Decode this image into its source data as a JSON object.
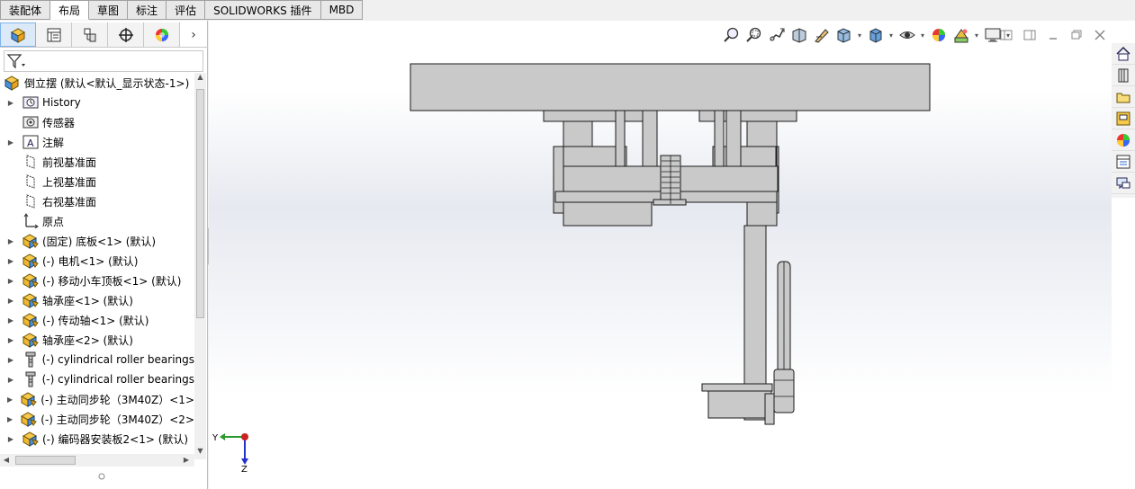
{
  "tabs": [
    {
      "label": "装配体",
      "active": false
    },
    {
      "label": "布局",
      "active": true
    },
    {
      "label": "草图",
      "active": false
    },
    {
      "label": "标注",
      "active": false
    },
    {
      "label": "评估",
      "active": false
    },
    {
      "label": "SOLIDWORKS 插件",
      "active": false
    },
    {
      "label": "MBD",
      "active": false
    }
  ],
  "feature_manager": {
    "panel_tabs": [
      "feature-tree-icon",
      "property-manager-icon",
      "config-manager-icon",
      "dimxpert-icon",
      "display-manager-icon"
    ],
    "more_arrow": "›",
    "filter_icon": "filter-icon",
    "root": {
      "label": "倒立摆  (默认<默认_显示状态-1>)",
      "icon": "assembly-icon"
    },
    "items": [
      {
        "label": "History",
        "icon": "history-icon",
        "expandable": true
      },
      {
        "label": "传感器",
        "icon": "sensor-icon",
        "expandable": false
      },
      {
        "label": "注解",
        "icon": "annotation-icon",
        "expandable": true
      },
      {
        "label": "前视基准面",
        "icon": "plane-icon",
        "expandable": false
      },
      {
        "label": "上视基准面",
        "icon": "plane-icon",
        "expandable": false
      },
      {
        "label": "右视基准面",
        "icon": "plane-icon",
        "expandable": false
      },
      {
        "label": "原点",
        "icon": "origin-icon",
        "expandable": false
      },
      {
        "label": "(固定) 底板<1> (默认)",
        "icon": "part-icon",
        "expandable": true
      },
      {
        "label": "(-) 电机<1> (默认)",
        "icon": "part-icon",
        "expandable": true
      },
      {
        "label": "(-) 移动小车顶板<1> (默认)",
        "icon": "part-icon",
        "expandable": true
      },
      {
        "label": "轴承座<1> (默认)",
        "icon": "part-icon",
        "expandable": true
      },
      {
        "label": "(-) 传动轴<1> (默认)",
        "icon": "part-icon",
        "expandable": true
      },
      {
        "label": "轴承座<2> (默认)",
        "icon": "part-icon",
        "expandable": true
      },
      {
        "label": "(-) cylindrical roller bearings",
        "icon": "toolbox-part-icon",
        "expandable": true
      },
      {
        "label": "(-) cylindrical roller bearings",
        "icon": "toolbox-part-icon",
        "expandable": true
      },
      {
        "label": "(-) 主动同步轮（3M40Z）<1>",
        "icon": "part-icon",
        "expandable": true
      },
      {
        "label": "(-) 主动同步轮（3M40Z）<2>",
        "icon": "part-icon",
        "expandable": true
      },
      {
        "label": "(-) 编码器安装板2<1> (默认)",
        "icon": "part-icon",
        "expandable": true
      }
    ]
  },
  "view_toolbar": [
    {
      "icon": "zoom-to-fit-icon"
    },
    {
      "icon": "zoom-to-area-icon"
    },
    {
      "icon": "previous-view-icon"
    },
    {
      "icon": "section-view-icon"
    },
    {
      "icon": "dynamic-annotation-icon"
    },
    {
      "icon": "view-orientation-icon",
      "dropdown": true
    },
    {
      "icon": "display-style-icon",
      "dropdown": true
    },
    {
      "icon": "hide-show-icon",
      "dropdown": true
    },
    {
      "icon": "edit-appearance-icon"
    },
    {
      "icon": "apply-scene-icon",
      "dropdown": true
    },
    {
      "icon": "view-settings-icon",
      "dropdown": true
    }
  ],
  "window_controls": [
    "restore-left-icon",
    "restore-right-icon",
    "minimize-icon",
    "maximize-icon",
    "close-icon"
  ],
  "task_pane": [
    "home-icon",
    "design-library-icon",
    "file-explorer-icon",
    "view-palette-icon",
    "appearances-icon",
    "custom-properties-icon",
    "forum-icon"
  ],
  "triad": {
    "axis_y": "Y",
    "axis_z": "Z"
  },
  "colors": {
    "part_fill": "#c9c9c9",
    "part_stroke": "#1a1a1a",
    "active_tab": "#dbe9f8",
    "accent": "#3a7bd5"
  }
}
